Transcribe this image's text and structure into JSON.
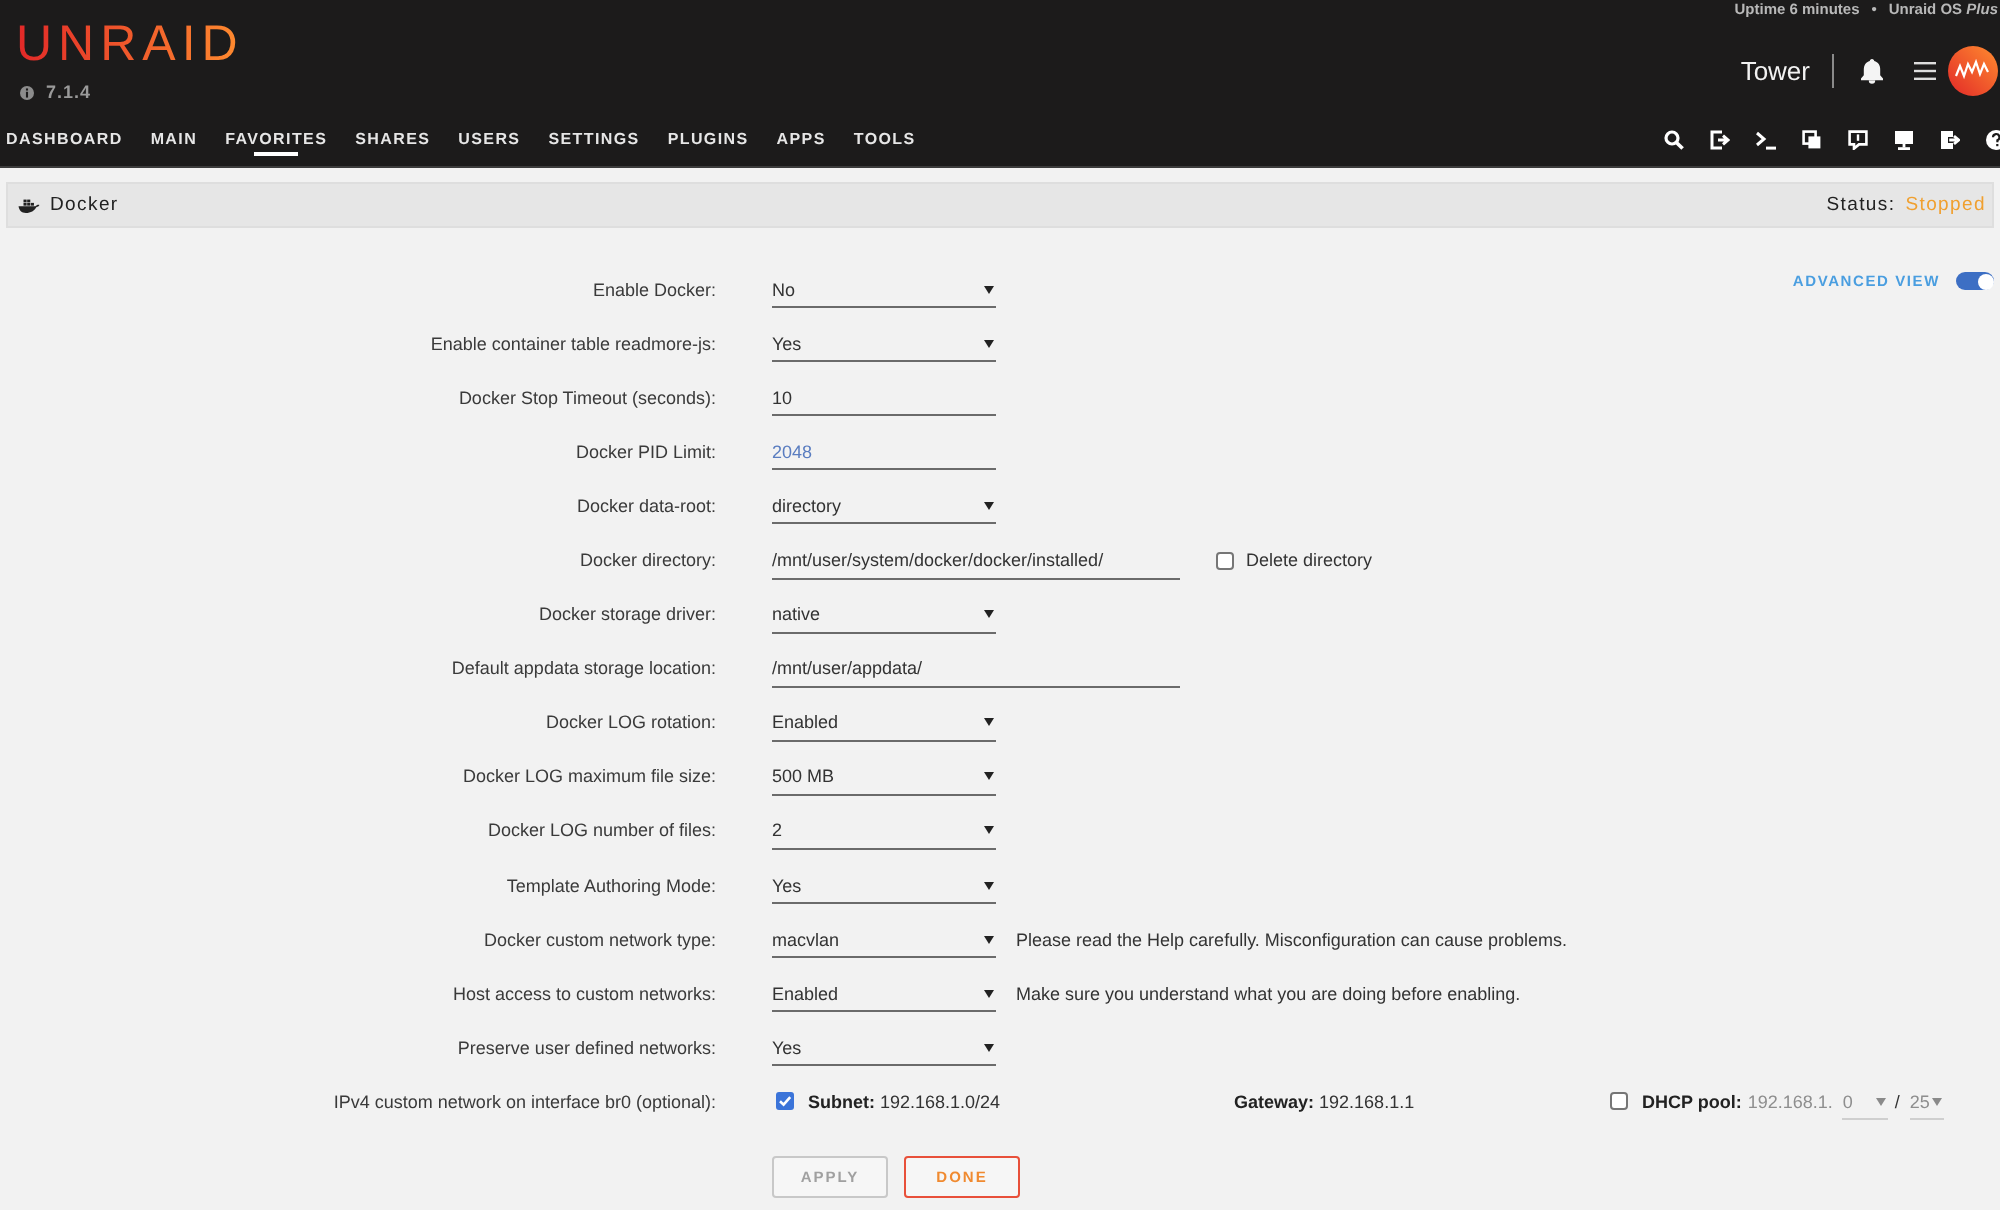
{
  "header": {
    "logo": "UNRAID",
    "version": "7.1.4",
    "uptime": "Uptime 6 minutes",
    "separator": "•",
    "license": "Unraid OS *Plus*",
    "server_name": "Tower"
  },
  "nav": {
    "items": [
      {
        "label": "DASHBOARD",
        "selected": false
      },
      {
        "label": "MAIN",
        "selected": false
      },
      {
        "label": "FAVORITES",
        "selected": true
      },
      {
        "label": "SHARES",
        "selected": false
      },
      {
        "label": "USERS",
        "selected": false
      },
      {
        "label": "SETTINGS",
        "selected": false
      },
      {
        "label": "PLUGINS",
        "selected": false
      },
      {
        "label": "APPS",
        "selected": false
      },
      {
        "label": "TOOLS",
        "selected": false
      }
    ]
  },
  "page": {
    "title": "Docker",
    "status_label": "Status:",
    "status": "Stopped"
  },
  "advanced_view": {
    "label": "ADVANCED VIEW",
    "on": true
  },
  "settings": [
    {
      "kind": "select",
      "label": "Enable Docker:",
      "value": "No"
    },
    {
      "kind": "select",
      "label": "Enable container table readmore-js:",
      "value": "Yes"
    },
    {
      "kind": "input",
      "label": "Docker Stop Timeout (seconds):",
      "value": "10"
    },
    {
      "kind": "input",
      "label": "Docker PID Limit:",
      "placeholder": "2048"
    },
    {
      "kind": "select",
      "label": "Docker data-root:",
      "value": "directory"
    },
    {
      "kind": "path",
      "label": "Docker directory:",
      "value": "/mnt/user/system/docker/docker/installed/",
      "option": {
        "label": "Delete directory",
        "checked": false
      }
    },
    {
      "kind": "select",
      "label": "Docker storage driver:",
      "value": "native"
    },
    {
      "kind": "path",
      "label": "Default appdata storage location:",
      "value": "/mnt/user/appdata/"
    },
    {
      "kind": "select",
      "label": "Docker LOG rotation:",
      "value": "Enabled"
    },
    {
      "kind": "select",
      "label": "Docker LOG maximum file size:",
      "value": "500 MB"
    },
    {
      "kind": "select",
      "label": "Docker LOG number of files:",
      "value": "2"
    },
    {
      "kind": "select",
      "label": "Template Authoring Mode:",
      "value": "Yes"
    },
    {
      "kind": "select",
      "label": "Docker custom network type:",
      "value": "macvlan",
      "note": "Please read the Help carefully. Misconfiguration can cause problems."
    },
    {
      "kind": "select",
      "label": "Host access to custom networks:",
      "value": "Enabled",
      "note": "Make sure you understand what you are doing before enabling."
    },
    {
      "kind": "select",
      "label": "Preserve user defined networks:",
      "value": "Yes"
    },
    {
      "kind": "network",
      "label": "IPv4 custom network on interface br0 (optional):",
      "subnet": {
        "checked": true,
        "text": "**Subnet:** 192.168.1.0/24"
      },
      "gateway": {
        "text": "**Gateway:** 192.168.1.1"
      },
      "dhcp": {
        "checked": false,
        "disabled": true,
        "label": "DHCP pool:",
        "prefix": "192.168.1.",
        "start": "0",
        "separator": "/",
        "size": "25"
      }
    }
  ],
  "buttons": [
    {
      "label": "APPLY",
      "disabled": true
    },
    {
      "label": "DONE",
      "disabled": false
    }
  ]
}
